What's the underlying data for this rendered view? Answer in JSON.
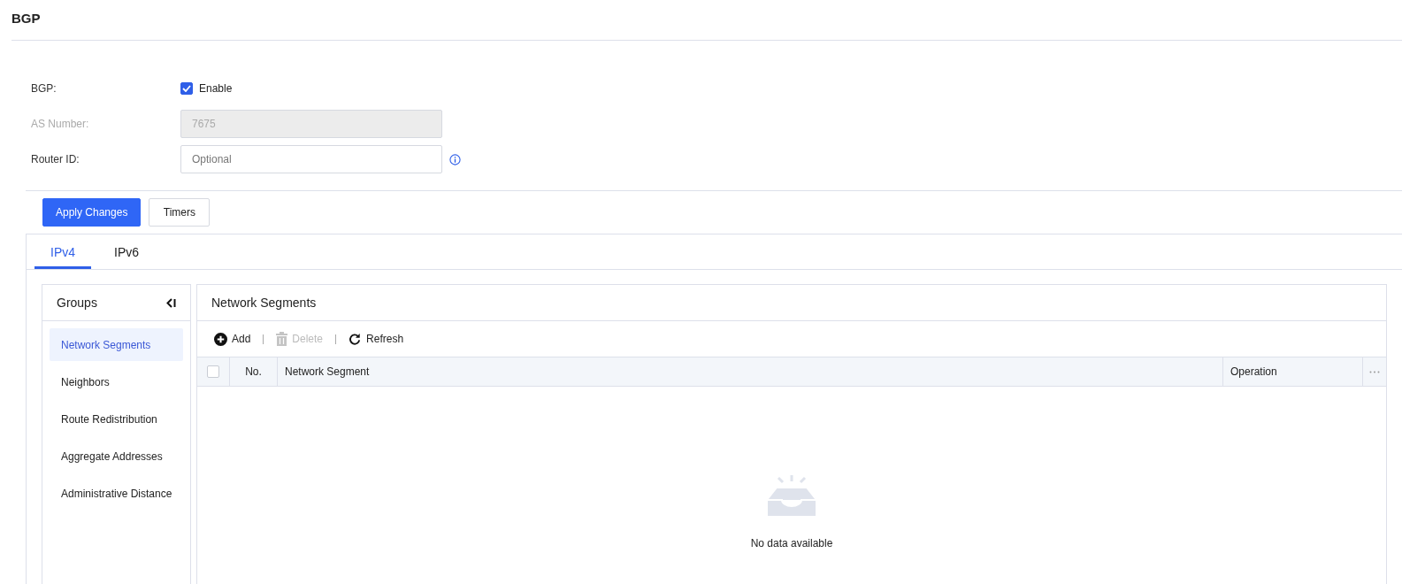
{
  "page": {
    "title": "BGP"
  },
  "form": {
    "bgp": {
      "label": "BGP:",
      "checked": true,
      "option": "Enable"
    },
    "as_number": {
      "label": "AS Number:",
      "value": "7675",
      "disabled": true
    },
    "router_id": {
      "label": "Router ID:",
      "placeholder": "Optional"
    }
  },
  "buttons": [
    {
      "label": "Apply Changes",
      "kind": "primary"
    },
    {
      "label": "Timers",
      "kind": "default"
    }
  ],
  "tabs": [
    {
      "label": "IPv4",
      "selected": true
    },
    {
      "label": "IPv6",
      "selected": false
    }
  ],
  "groups": {
    "title": "Groups",
    "items": [
      {
        "label": "Network Segments",
        "selected": true
      },
      {
        "label": "Neighbors",
        "selected": false
      },
      {
        "label": "Route Redistribution",
        "selected": false
      },
      {
        "label": "Aggregate Addresses",
        "selected": false
      },
      {
        "label": "Administrative Distance",
        "selected": false
      }
    ]
  },
  "content": {
    "title": "Network Segments",
    "toolbar": [
      {
        "label": "Add",
        "kind": "add",
        "disabled": false
      },
      {
        "label": "Delete",
        "kind": "delete",
        "disabled": true
      },
      {
        "label": "Refresh",
        "kind": "refresh",
        "disabled": false
      }
    ],
    "table": {
      "select_all_checked": false,
      "columns": [
        "No.",
        "Network Segment",
        "Operation"
      ],
      "empty_text": "No data available"
    }
  }
}
